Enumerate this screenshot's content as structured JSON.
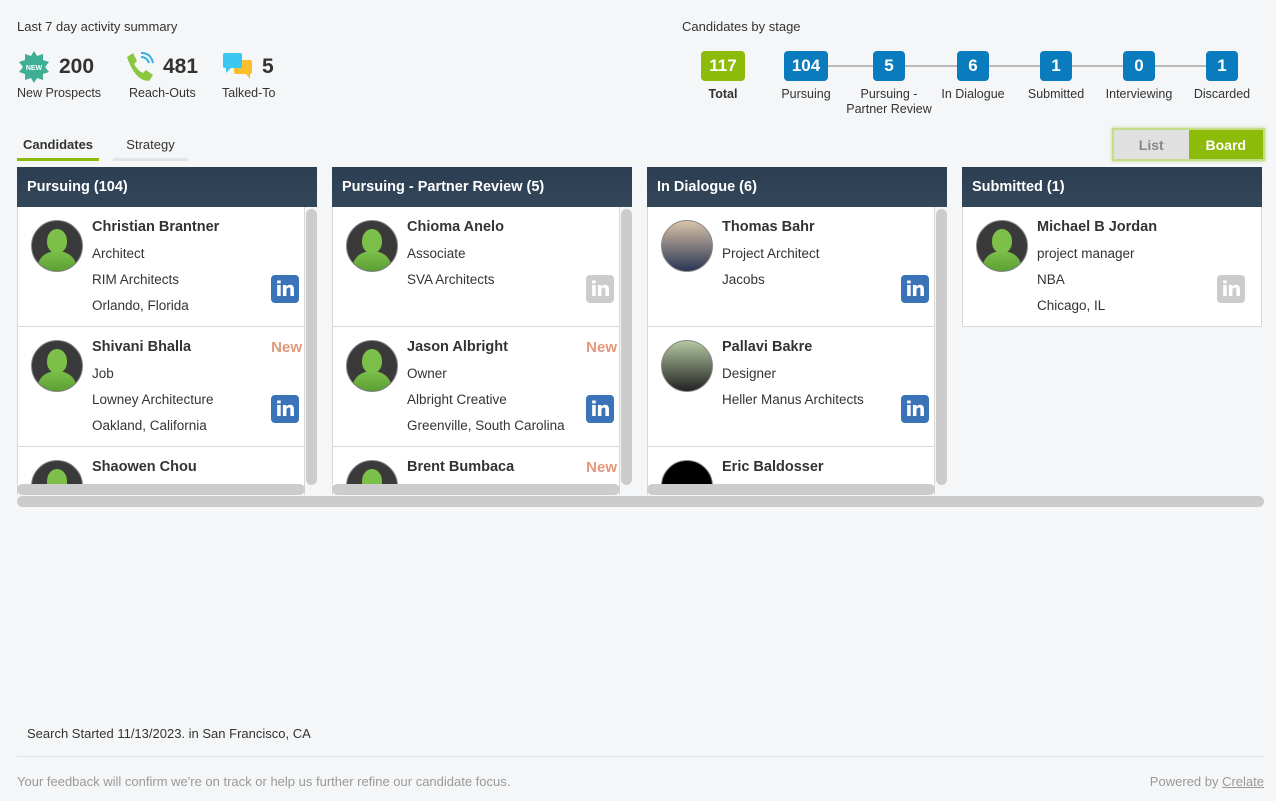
{
  "summary": {
    "title": "Last 7 day activity summary",
    "stats": [
      {
        "icon": "new-badge-icon",
        "badge": "NEW",
        "value": "200",
        "label": "New Prospects"
      },
      {
        "icon": "phone-icon",
        "value": "481",
        "label": "Reach-Outs"
      },
      {
        "icon": "chat-bubbles-icon",
        "value": "5",
        "label": "Talked-To"
      }
    ]
  },
  "stages": {
    "title": "Candidates by stage",
    "items": [
      {
        "value": "117",
        "label": "Total",
        "color": "#8dbb0a"
      },
      {
        "value": "104",
        "label": "Pursuing",
        "color": "#0a7bbd"
      },
      {
        "value": "5",
        "label": "Pursuing - Partner Review",
        "color": "#0a7bbd"
      },
      {
        "value": "6",
        "label": "In Dialogue",
        "color": "#0a7bbd"
      },
      {
        "value": "1",
        "label": "Submitted",
        "color": "#0a7bbd"
      },
      {
        "value": "0",
        "label": "Interviewing",
        "color": "#0a7bbd"
      },
      {
        "value": "1",
        "label": "Discarded",
        "color": "#0a7bbd"
      }
    ]
  },
  "tabs": [
    {
      "label": "Candidates",
      "active": true
    },
    {
      "label": "Strategy",
      "active": false
    }
  ],
  "view_toggle": {
    "list": "List",
    "board": "Board",
    "selected": "Board"
  },
  "columns": [
    {
      "title": "Pursuing (104)",
      "cards": [
        {
          "name": "Christian Brantner",
          "lines": [
            "Architect",
            "RIM Architects",
            "Orlando, Florida"
          ],
          "new": false,
          "linkedin": "active",
          "avatar": "placeholder"
        },
        {
          "name": "Shivani Bhalla",
          "lines": [
            "Job",
            "Lowney Architecture",
            "Oakland, California"
          ],
          "new": true,
          "linkedin": "active",
          "avatar": "placeholder"
        },
        {
          "name": "Shaowen Chou",
          "lines": [],
          "new": false,
          "linkedin": "none",
          "avatar": "placeholder"
        }
      ]
    },
    {
      "title": "Pursuing - Partner Review (5)",
      "cards": [
        {
          "name": "Chioma Anelo",
          "lines": [
            "Associate",
            "SVA Architects"
          ],
          "new": false,
          "linkedin": "inactive",
          "avatar": "placeholder"
        },
        {
          "name": "Jason Albright",
          "lines": [
            "Owner",
            "Albright Creative",
            "Greenville, South Carolina"
          ],
          "new": true,
          "linkedin": "active",
          "avatar": "placeholder"
        },
        {
          "name": "Brent Bumbaca",
          "lines": [],
          "new": true,
          "linkedin": "none",
          "avatar": "placeholder"
        }
      ]
    },
    {
      "title": "In Dialogue (6)",
      "cards": [
        {
          "name": "Thomas Bahr",
          "lines": [
            "Project Architect",
            "Jacobs"
          ],
          "new": false,
          "linkedin": "active",
          "avatar": "photo"
        },
        {
          "name": "Pallavi Bakre",
          "lines": [
            "Designer",
            "Heller Manus Architects"
          ],
          "new": false,
          "linkedin": "active",
          "avatar": "photo2"
        },
        {
          "name": "Eric Baldosser",
          "lines": [],
          "new": false,
          "linkedin": "none",
          "avatar": "black"
        }
      ]
    },
    {
      "title": "Submitted (1)",
      "cards": [
        {
          "name": "Michael B Jordan",
          "lines": [
            "project manager",
            "NBA",
            "Chicago, IL"
          ],
          "new": false,
          "linkedin": "inactive",
          "avatar": "placeholder"
        }
      ]
    }
  ],
  "new_label": "New",
  "linkedin_label": "in",
  "footer": {
    "search_started": "Search Started 11/13/2023. in San Francisco, CA",
    "feedback": "Your feedback will confirm we're on track or help us further refine our candidate focus.",
    "powered_by": "Powered by",
    "brand": "Crelate"
  }
}
